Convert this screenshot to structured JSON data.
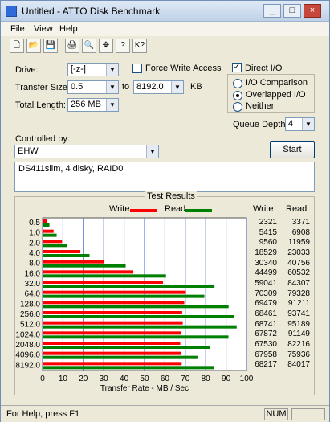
{
  "window": {
    "title": "Untitled - ATTO Disk Benchmark",
    "minimize": "_",
    "maximize": "□",
    "close": "×"
  },
  "menu": [
    "File",
    "View",
    "Help"
  ],
  "toolbar": {
    "new": "🗋",
    "open": "📂",
    "save": "💾",
    "print": "🖨",
    "preview": "🔍",
    "move": "✥",
    "help": "?",
    "context_help": "K?"
  },
  "controls": {
    "drive_label": "Drive:",
    "drive_value": "[-z-]",
    "force_write_label": "Force Write Access",
    "force_write_checked": false,
    "direct_io_label": "Direct I/O",
    "direct_io_checked": true,
    "transfer_label": "Transfer Size:",
    "transfer_from": "0.5",
    "to_label": "to",
    "transfer_to": "8192.0",
    "kb_label": "KB",
    "total_length_label": "Total Length:",
    "total_length_value": "256 MB",
    "io_comparison_label": "I/O Comparison",
    "overlapped_io_label": "Overlapped I/O",
    "neither_label": "Neither",
    "selected_mode": "Overlapped I/O",
    "queue_depth_label": "Queue Depth:",
    "queue_depth_value": "4",
    "controlled_by_label": "Controlled by:",
    "controlled_by_value": "EHW",
    "start_label": "Start",
    "description": "DS411slim, 4 disky, RAID0"
  },
  "results": {
    "title": "Test Results",
    "write_label": "Write",
    "read_label": "Read",
    "write_color": "#ff0000",
    "read_color": "#008000",
    "write_header": "Write",
    "read_header": "Read",
    "rows": [
      {
        "size": "0.5",
        "write": "2321",
        "read": "3371"
      },
      {
        "size": "1.0",
        "write": "5415",
        "read": "6908"
      },
      {
        "size": "2.0",
        "write": "9560",
        "read": "11959"
      },
      {
        "size": "4.0",
        "write": "18529",
        "read": "23033"
      },
      {
        "size": "8.0",
        "write": "30340",
        "read": "40756"
      },
      {
        "size": "16.0",
        "write": "44499",
        "read": "60532"
      },
      {
        "size": "32.0",
        "write": "59041",
        "read": "84307"
      },
      {
        "size": "64.0",
        "write": "70309",
        "read": "79328"
      },
      {
        "size": "128.0",
        "write": "69479",
        "read": "91211"
      },
      {
        "size": "256.0",
        "write": "68461",
        "read": "93741"
      },
      {
        "size": "512.0",
        "write": "68741",
        "read": "95189"
      },
      {
        "size": "1024.0",
        "write": "67872",
        "read": "91149"
      },
      {
        "size": "2048.0",
        "write": "67530",
        "read": "82216"
      },
      {
        "size": "4096.0",
        "write": "67958",
        "read": "75936"
      },
      {
        "size": "8192.0",
        "write": "68217",
        "read": "84017"
      }
    ]
  },
  "chart_data": {
    "type": "bar",
    "categories": [
      "0.5",
      "1.0",
      "2.0",
      "4.0",
      "8.0",
      "16.0",
      "32.0",
      "64.0",
      "128.0",
      "256.0",
      "512.0",
      "1024.0",
      "2048.0",
      "4096.0",
      "8192.0"
    ],
    "series": [
      {
        "name": "Write",
        "values": [
          2.321,
          5.415,
          9.56,
          18.529,
          30.34,
          44.499,
          59.041,
          70.309,
          69.479,
          68.461,
          68.741,
          67.872,
          67.53,
          67.958,
          68.217
        ]
      },
      {
        "name": "Read",
        "values": [
          3.371,
          6.908,
          11.959,
          23.033,
          40.756,
          60.532,
          84.307,
          79.328,
          91.211,
          93.741,
          95.189,
          91.149,
          82.216,
          75.936,
          84.017
        ]
      }
    ],
    "xlabel": "Transfer Rate - MB / Sec",
    "ylabel": "",
    "xlim": [
      0,
      100
    ],
    "xticks": [
      "0",
      "10",
      "20",
      "30",
      "40",
      "50",
      "60",
      "70",
      "80",
      "90",
      "100"
    ],
    "grid": true,
    "legend": "top"
  },
  "status": {
    "help": "For Help, press F1",
    "num": "NUM"
  }
}
